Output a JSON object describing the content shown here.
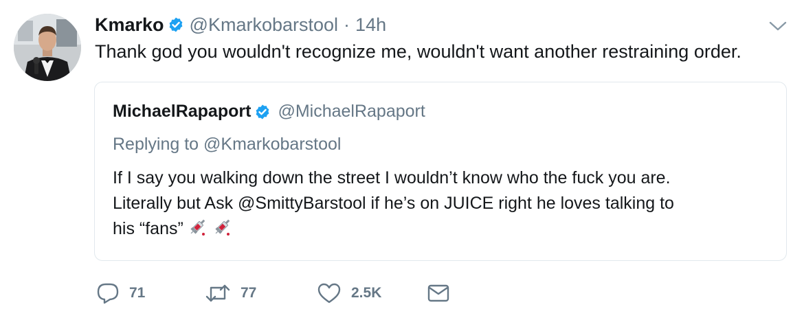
{
  "tweet": {
    "author_name": "Kmarko",
    "author_handle": "@Kmarkobarstool",
    "separator": "·",
    "time": "14h",
    "text": "Thank god you wouldn't recognize me, wouldn't want another restraining order."
  },
  "quoted": {
    "author_name": "MichaelRapaport",
    "author_handle": "@MichaelRapaport",
    "replying_to": "Replying to @Kmarkobarstool",
    "lines": [
      "If I say you walking down the street I wouldn’t know who the fuck you are.",
      "Literally but Ask @SmittyBarstool if he’s on JUICE right he loves talking to",
      "his “fans”"
    ],
    "emojis": [
      "syringe-icon",
      "syringe-icon"
    ]
  },
  "actions": {
    "replies": "71",
    "retweets": "77",
    "likes": "2.5K"
  },
  "colors": {
    "text": "#14171a",
    "secondary": "#657786",
    "verified": "#1da1f2",
    "border": "#e1e8ed"
  }
}
